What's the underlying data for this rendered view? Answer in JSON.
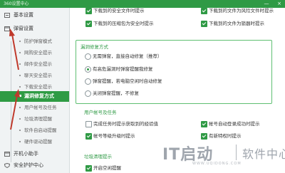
{
  "window": {
    "title": "360设置中心",
    "controls": [
      "—",
      "×"
    ]
  },
  "sidebar": {
    "items": [
      {
        "label": "基本设置",
        "icon": "settings-icon"
      },
      {
        "label": "弹窗设置",
        "icon": "popup-icon"
      }
    ],
    "sub_items": [
      "防护弹窗模式",
      "网购安全提示",
      "邮件安全提示",
      "聊天安全提示",
      "下载安全提示",
      "漏洞修复方式",
      "用户帐号及任务",
      "垃圾清理提醒",
      "软件自启动提醒",
      "硬件驱动提醒"
    ],
    "active_sub": "漏洞修复方式",
    "bottom_items": [
      {
        "label": "开机小助手",
        "icon": "startup-icon"
      },
      {
        "label": "安全护护中心",
        "icon": "shield-icon"
      }
    ]
  },
  "top_checks": [
    {
      "label": "下载到的安全文件时提示",
      "checked": true
    },
    {
      "label": "下载到的文件为风险文件时提示",
      "checked": true
    },
    {
      "label": "下载到的压缩包为安全时提示",
      "checked": true
    },
    {
      "label": "下载到的文件为锁器时提示",
      "checked": true
    }
  ],
  "vuln_group": {
    "title": "漏洞修复方式",
    "options": [
      {
        "label": "无需弹窗，直接自动修复（推荐）",
        "selected": false
      },
      {
        "label": "有高危漏洞时弹窗提醒我修复",
        "selected": true
      },
      {
        "label": "弹窗提醒，若电脑空闲时自动修复",
        "selected": false
      },
      {
        "label": "关闭弹窗提醒，不修复",
        "selected": false
      }
    ]
  },
  "account_section": {
    "title": "用户帐号及任务",
    "checks": [
      {
        "label": "完成任务时提示获取到的经验值",
        "checked": false
      },
      {
        "label": "帐号自动登录成功时提示",
        "checked": true
      },
      {
        "label": "帐号等级升级时提示",
        "checked": true
      },
      {
        "label": "有新特权时提示",
        "checked": true
      }
    ]
  },
  "cleanup_section": {
    "title": "垃圾清理提示",
    "checks": [
      {
        "label": "开启空闲提醒",
        "checked": true
      }
    ]
  },
  "watermark": {
    "brand": "IT启动",
    "cn": "软件中心",
    "url": "WWW.UQIDONG.COM"
  },
  "colors": {
    "accent": "#2f9a45",
    "arrow": "#c0392b"
  }
}
